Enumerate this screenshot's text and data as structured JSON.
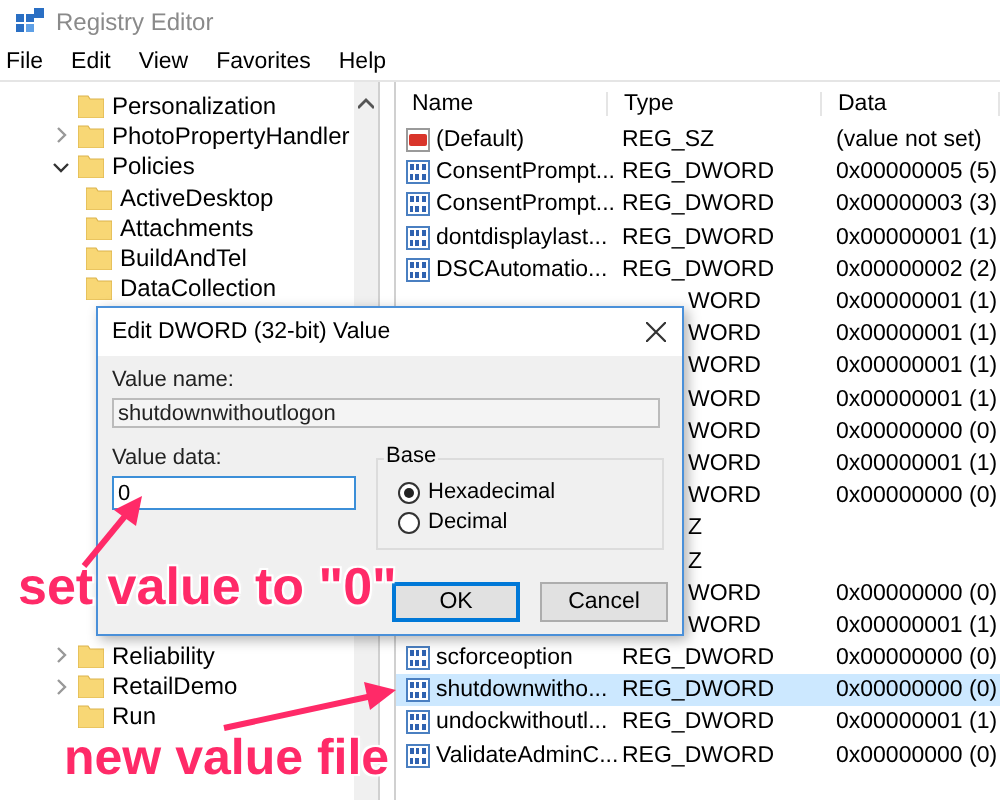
{
  "window": {
    "title": "Registry Editor"
  },
  "menu": [
    "File",
    "Edit",
    "View",
    "Favorites",
    "Help"
  ],
  "tree": [
    {
      "label": "Personalization"
    },
    {
      "label": "PhotoPropertyHandler",
      "expanded": false
    },
    {
      "label": "Policies",
      "expanded": true,
      "children": [
        {
          "label": "ActiveDesktop"
        },
        {
          "label": "Attachments"
        },
        {
          "label": "BuildAndTel"
        },
        {
          "label": "DataCollection"
        }
      ]
    },
    {
      "label": "Reliability",
      "expanded": false
    },
    {
      "label": "RetailDemo",
      "expanded": false
    },
    {
      "label": "Run"
    }
  ],
  "list": {
    "columns": [
      "Name",
      "Type",
      "Data"
    ],
    "rows": [
      {
        "kind": "string",
        "name": "(Default)",
        "type": "REG_SZ",
        "data": "(value not set)",
        "selected": false
      },
      {
        "kind": "dword",
        "name": "ConsentPrompt...",
        "type": "REG_DWORD",
        "data": "0x00000005 (5)",
        "selected": false
      },
      {
        "kind": "dword",
        "name": "ConsentPrompt...",
        "type": "REG_DWORD",
        "data": "0x00000003 (3)",
        "selected": false
      },
      {
        "kind": "dword",
        "name": "dontdisplaylast...",
        "type": "REG_DWORD",
        "data": "0x00000001 (1)",
        "selected": false
      },
      {
        "kind": "dword",
        "name": "DSCAutomatio...",
        "type": "REG_DWORD",
        "data": "0x00000002 (2)",
        "selected": false
      },
      {
        "kind": "covered",
        "type": "WORD",
        "data": "0x00000001 (1)",
        "selected": false
      },
      {
        "kind": "covered",
        "type": "WORD",
        "data": "0x00000001 (1)",
        "selected": false
      },
      {
        "kind": "covered",
        "type": "WORD",
        "data": "0x00000001 (1)",
        "selected": false
      },
      {
        "kind": "covered",
        "type": "WORD",
        "data": "0x00000001 (1)",
        "selected": false
      },
      {
        "kind": "covered",
        "type": "WORD",
        "data": "0x00000000 (0)",
        "selected": false
      },
      {
        "kind": "covered",
        "type": "WORD",
        "data": "0x00000001 (1)",
        "selected": false
      },
      {
        "kind": "covered",
        "type": "WORD",
        "data": "0x00000000 (0)",
        "selected": false
      },
      {
        "kind": "covered",
        "type": "Z",
        "selected": false
      },
      {
        "kind": "covered",
        "type": "Z",
        "selected": false
      },
      {
        "kind": "covered",
        "type": "WORD",
        "data": "0x00000000 (0)",
        "selected": false
      },
      {
        "kind": "covered",
        "type": "WORD",
        "data": "0x00000001 (1)",
        "selected": false
      },
      {
        "kind": "dword",
        "name": "scforceoption",
        "type": "REG_DWORD",
        "data": "0x00000000 (0)",
        "selected": false
      },
      {
        "kind": "dword",
        "name": "shutdownwitho...",
        "type": "REG_DWORD",
        "data": "0x00000000 (0)",
        "selected": true
      },
      {
        "kind": "dword",
        "name": "undockwithoutl...",
        "type": "REG_DWORD",
        "data": "0x00000001 (1)",
        "selected": false
      },
      {
        "kind": "dword",
        "name": "ValidateAdminC...",
        "type": "REG_DWORD",
        "data": "0x00000000 (0)",
        "selected": false
      }
    ]
  },
  "dialog": {
    "title": "Edit DWORD (32-bit) Value",
    "name_label": "Value name:",
    "name_value": "shutdownwithoutlogon",
    "data_label": "Value data:",
    "data_value": "0",
    "base_label": "Base",
    "base_options": [
      {
        "label": "Hexadecimal",
        "selected": true
      },
      {
        "label": "Decimal",
        "selected": false
      }
    ],
    "buttons": [
      {
        "label": "OK",
        "default": true
      },
      {
        "label": "Cancel",
        "default": false
      }
    ]
  },
  "annotations": [
    {
      "text": "set value to \"0\""
    },
    {
      "text": "new value file"
    }
  ]
}
